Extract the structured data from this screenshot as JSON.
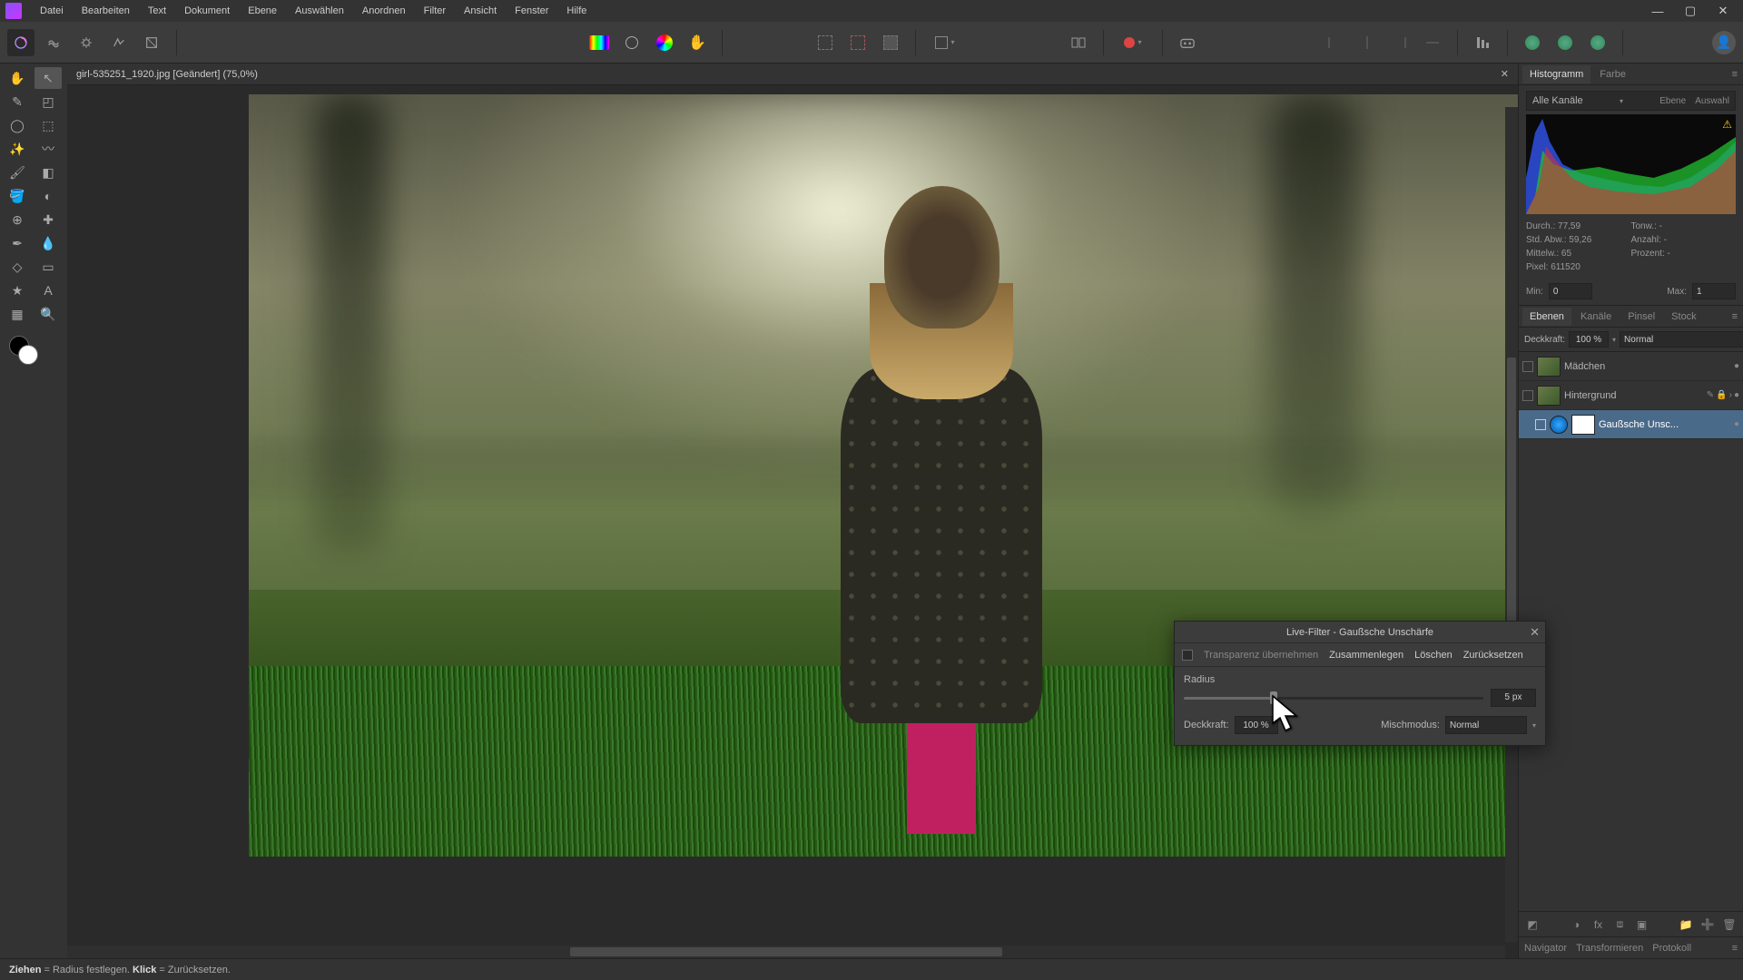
{
  "menu": [
    "Datei",
    "Bearbeiten",
    "Text",
    "Dokument",
    "Ebene",
    "Auswählen",
    "Anordnen",
    "Filter",
    "Ansicht",
    "Fenster",
    "Hilfe"
  ],
  "document": {
    "tab_title": "girl-535251_1920.jpg [Geändert] (75,0%)"
  },
  "histogram_panel": {
    "tabs": [
      "Histogramm",
      "Farbe"
    ],
    "channel_dropdown": "Alle Kanäle",
    "toggle1": "Ebene",
    "toggle2": "Auswahl",
    "stats": {
      "mean_label": "Durch.:",
      "mean_value": "77,59",
      "stddev_label": "Std. Abw.:",
      "stddev_value": "59,26",
      "median_label": "Mittelw.:",
      "median_value": "65",
      "pixels_label": "Pixel:",
      "pixels_value": "611520",
      "tone_label": "Tonw.:",
      "tone_value": "-",
      "count_label": "Anzahl:",
      "count_value": "-",
      "percent_label": "Prozent:",
      "percent_value": "-"
    },
    "min_label": "Min:",
    "min_value": "0",
    "max_label": "Max:",
    "max_value": "1"
  },
  "layers_panel": {
    "tabs": [
      "Ebenen",
      "Kanäle",
      "Pinsel",
      "Stock"
    ],
    "opacity_label": "Deckkraft:",
    "opacity_value": "100 %",
    "blend_value": "Normal",
    "layers": [
      {
        "name": "Mädchen"
      },
      {
        "name": "Hintergrund"
      },
      {
        "name": "Gaußsche Unsc..."
      }
    ]
  },
  "bottom_tabs": [
    "Navigator",
    "Transformieren",
    "Protokoll"
  ],
  "dialog": {
    "title": "Live-Filter - Gaußsche Unschärfe",
    "preserve_alpha": "Transparenz übernehmen",
    "merge": "Zusammenlegen",
    "delete": "Löschen",
    "reset": "Zurücksetzen",
    "radius_label": "Radius",
    "radius_value": "5 px",
    "opacity_label": "Deckkraft:",
    "opacity_value": "100 %",
    "blend_label": "Mischmodus:",
    "blend_value": "Normal"
  },
  "statusbar": {
    "drag_label": "Ziehen",
    "drag_text": " = Radius festlegen. ",
    "click_label": "Klick",
    "click_text": " = Zurücksetzen."
  }
}
